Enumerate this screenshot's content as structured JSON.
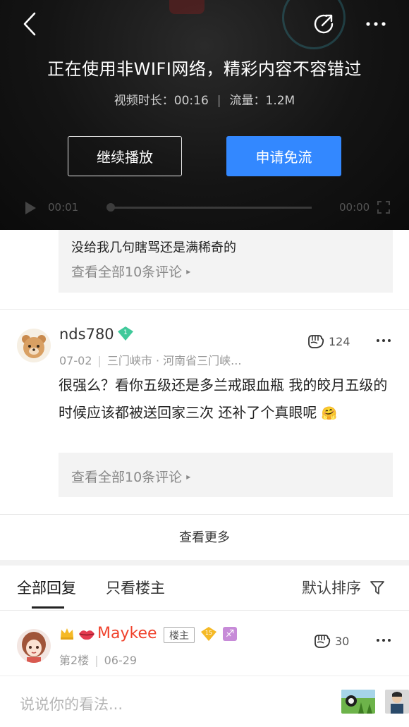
{
  "video": {
    "notice_title": "正在使用非WIFI网络，精彩内容不容错过",
    "duration_label": "视频时长：00:16",
    "traffic_label": "流量：1.2M",
    "separator": "|",
    "continue_label": "继续播放",
    "free_flow_label": "申请免流",
    "time_current": "00:01",
    "time_total": "00:00",
    "progress": 0
  },
  "comments": [
    {
      "reply_preview": "没给我几句瞎骂还是满稀奇的",
      "view_all_label": "查看全部10条评论"
    },
    {
      "username": "nds780",
      "level": "1",
      "date": "07-02",
      "location": "三门峡市 · 河南省三门峡...",
      "likes": "124",
      "body": "很强么？看你五级还是多兰戒跟血瓶 我的皎月五级的时候应该都被送回家三次 还补了个真眼呢",
      "emoji": "🤗",
      "view_all_label": "查看全部10条评论"
    }
  ],
  "view_more_label": "查看更多",
  "tabs": {
    "all_label": "全部回复",
    "op_only_label": "只看楼主",
    "sort_label": "默认排序"
  },
  "floor_post": {
    "username": "Maykee",
    "op_tag": "楼主",
    "level": "15",
    "floor": "第2楼",
    "date": "06-29",
    "likes": "30"
  },
  "input": {
    "placeholder": "说说你的看法..."
  },
  "colors": {
    "accent_blue": "#3388ff",
    "vip_red": "#f0422c",
    "level_green": "#3fc99a",
    "level_gold": "#f5b925"
  }
}
